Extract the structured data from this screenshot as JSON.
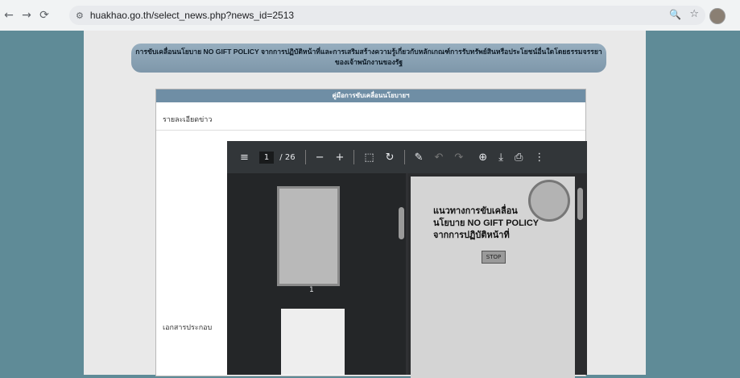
{
  "browser": {
    "url": "huakhao.go.th/select_news.php?news_id=2513"
  },
  "page": {
    "title": "การขับเคลื่อนนโยบาย NO GIFT POLICY จากการปฏิบัติหน้าที่และการเสริมสร้างความรู้เกี่ยวกับหลักเกณฑ์การรับทรัพย์สินหรือประโยชน์อื่นใดโดยธรรมจรรยา ของเจ้าพนักงานของรัฐ",
    "card_header": "คู่มือการขับเคลื่อนนโยบายฯ",
    "detail_label": "รายละเอียดข่าว",
    "attachment_label": "เอกสารประกอบ"
  },
  "pdf": {
    "current_page": "1",
    "total_pages": "/ 26",
    "thumb_number": "1",
    "cover_title_1": "แนวทางการขับเคลื่อน",
    "cover_title_2": "นโยบาย NO GIFT POLICY",
    "cover_title_3": "จากการปฏิบัติหน้าที่",
    "stop_text": "STOP"
  }
}
